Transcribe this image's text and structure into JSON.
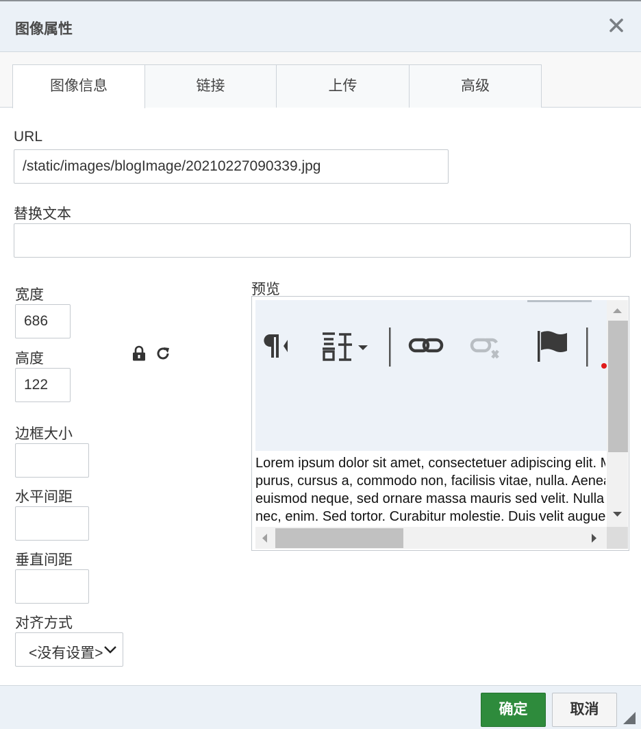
{
  "dialog": {
    "title": "图像属性"
  },
  "tabs": [
    {
      "label": "图像信息",
      "active": true
    },
    {
      "label": "链接",
      "active": false
    },
    {
      "label": "上传",
      "active": false
    },
    {
      "label": "高级",
      "active": false
    }
  ],
  "fields": {
    "url": {
      "label": "URL",
      "value": "/static/images/blogImage/20210227090339.jpg"
    },
    "alt": {
      "label": "替换文本",
      "value": ""
    },
    "width": {
      "label": "宽度",
      "value": "686"
    },
    "height": {
      "label": "高度",
      "value": "122"
    },
    "border": {
      "label": "边框大小",
      "value": ""
    },
    "hspace": {
      "label": "水平间距",
      "value": ""
    },
    "vspace": {
      "label": "垂直间距",
      "value": ""
    },
    "align": {
      "label": "对齐方式",
      "value": "<没有设置>"
    }
  },
  "preview": {
    "label": "预览",
    "lines": [
      "Lorem ipsum dolor sit amet, consectetuer adipiscing elit. Maecenas feugiat consequat diam. Maecenas metus. Vivamus diam",
      "purus, cursus a, commodo non, facilisis vitae, nulla. Aenean dictum lacinia tortor. Nunc iaculis, nibh non iaculis aliquam, orci felis",
      "euismod neque, sed ornare massa mauris sed velit. Nulla pretium mi et risus. Fusce mi pede, tempor id, cursus ac, ullamcorper",
      "nec, enim. Sed tortor. Curabitur molestie. Duis velit augue, condimentum at, ultrices a, luctus ut, orci. Donec pellentesque egestas"
    ]
  },
  "footer": {
    "ok_label": "确定",
    "cancel_label": "取消"
  },
  "colors": {
    "header_bg": "#ebf1f7",
    "ok_button": "#2e8b3c"
  },
  "icons": {
    "close": "close-icon",
    "lock": "lock-icon",
    "reset": "reset-size-icon"
  }
}
